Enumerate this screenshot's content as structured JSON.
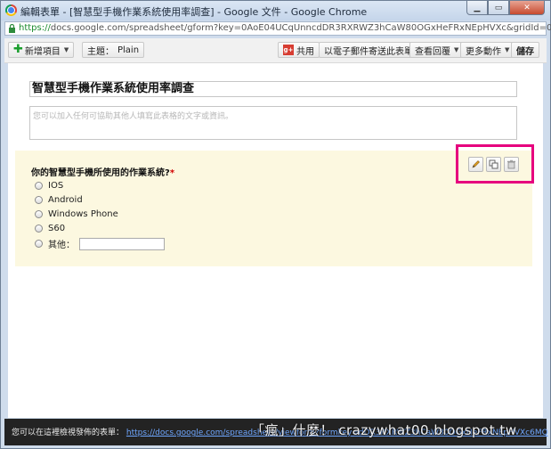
{
  "window": {
    "title": "編輯表單 - [智慧型手機作業系統使用率調查] - Google 文件 - Google Chrome",
    "minimize_icon": "minimize-icon",
    "maximize_icon": "maximize-icon",
    "close_icon": "close-icon"
  },
  "address": {
    "scheme": "https://",
    "rest": "docs.google.com/spreadsheet/gform?key=0AoE04UCqUnncdDR3RXRWZ3hCaW80OGxHeFRxNEpHVXc&gridId=0#edit"
  },
  "toolbar": {
    "add_item": "新增項目",
    "theme_label": "主題：",
    "theme_value": "Plain",
    "share": "共用",
    "email_form": "以電子郵件寄送此表單",
    "view_responses": "查看回覆",
    "more_actions": "更多動作",
    "save": "儲存"
  },
  "form": {
    "title": "智慧型手機作業系統使用率調查",
    "description_placeholder": "您可以加入任何可協助其他人填寫此表格的文字或資訊。"
  },
  "question": {
    "title": "你的智慧型手機所使用的作業系統?",
    "required_mark": "*",
    "options": [
      "IOS",
      "Android",
      "Windows Phone",
      "S60"
    ],
    "other_label": "其他："
  },
  "status": {
    "text": "您可以在這裡檢視發佈的表單：",
    "link": "https://docs.google.com/spreadsheet/viewform?formkey=dDR3RXRWZ3hCaW80OGxHeFRxNEpHVXc6MQ"
  },
  "watermark": "「瘋」什麼！ crazywhat00.blogspot.tw",
  "colors": {
    "highlight": "#e6007e",
    "question_bg": "#fcf8e0",
    "required": "#d20000"
  }
}
